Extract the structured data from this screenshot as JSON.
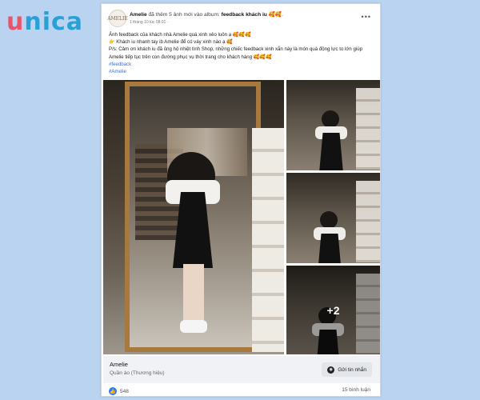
{
  "brand": {
    "logo_first": "u",
    "logo_rest": "nica"
  },
  "post": {
    "author": "Amelie",
    "action_text": " đã thêm 5 ảnh mới vào album: ",
    "album": "feedback khách iu",
    "album_emoji": "🥰🥰.",
    "timestamp": "1 tháng 10 lúc 08:01 ·",
    "avatar_text": "AMELIE",
    "caption": {
      "line1": "Ảnh feedback của khách nhà Amelie quá xinh xẻo luôn ạ ",
      "line1_emoji": "🥰🥰🥰",
      "line2_hand": "👉",
      "line2": " Khách iu nhanh tay ib Amelie để có váy xinh nào ạ ",
      "line2_emoji": "🥰",
      "line3": "P/s: Cảm ơn khách iu đã ủng hộ nhiệt tình Shop, những chiếc feedback xinh xắn này là món quà động lực to lớn giúp Amelie tiếp tục trên con đường phục vụ thời trang cho khách hàng ",
      "line3_emoji": "🥰🥰🥰",
      "hashtag1": "#feedback",
      "hashtag2": "#Amelie"
    },
    "more_photos": "+2",
    "page_name": "Amelie",
    "page_category": "Quần áo (Thương hiệu)",
    "message_button": "Gửi tin nhắn",
    "likes": "548",
    "comments": "15 bình luận"
  },
  "icons": {
    "more": "•••",
    "close": "✕",
    "like": "👍",
    "messenger": "◉"
  },
  "colors": {
    "background": "#b9d3f0",
    "logo_accent": "#e8546a",
    "logo_main": "#2aa1d6",
    "hashtag": "#3a6fd8",
    "like": "#2d7cf6"
  }
}
